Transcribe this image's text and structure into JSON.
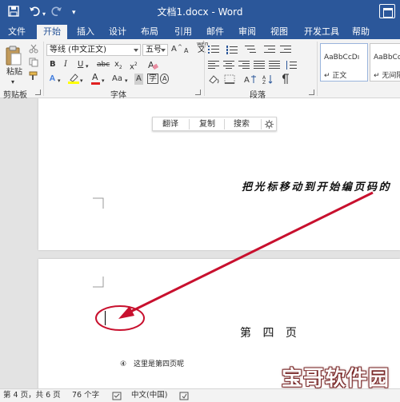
{
  "app": {
    "title": "文档1.docx - Word"
  },
  "quick_access": {
    "save_icon": "save-icon",
    "undo_icon": "undo-icon",
    "redo_icon": "redo-icon",
    "customize_icon": "customize-icon"
  },
  "tabs": [
    {
      "label": "文件"
    },
    {
      "label": "开始",
      "active": true
    },
    {
      "label": "插入"
    },
    {
      "label": "设计"
    },
    {
      "label": "布局"
    },
    {
      "label": "引用"
    },
    {
      "label": "邮件"
    },
    {
      "label": "审阅"
    },
    {
      "label": "视图"
    },
    {
      "label": "开发工具"
    },
    {
      "label": "帮助"
    }
  ],
  "ribbon": {
    "clipboard": {
      "paste_label": "粘贴",
      "group_label": "剪贴板"
    },
    "font": {
      "font_name": "等线 (中文正文)",
      "font_size": "五号",
      "grow": "A",
      "shrink": "A",
      "change_case": "Aa",
      "wen": "wén",
      "wen_glyph": "文",
      "bold": "B",
      "italic": "I",
      "underline": "U",
      "strike": "abc",
      "sub": "x",
      "sup": "x",
      "text_effect": "A",
      "font_color": "A",
      "shading_char": "A",
      "border_char": "字",
      "circle_char": "A",
      "group_label": "字体"
    },
    "paragraph": {
      "group_label": "段落"
    },
    "styles": {
      "items": [
        {
          "sample": "AaBbCcDı",
          "name": "↵ 正文"
        },
        {
          "sample": "AaBbCcDı",
          "name": "↵ 无间隔"
        }
      ]
    },
    "colors": {
      "ribbon_blue": "#2b579a",
      "font_color_red": "#e02020",
      "highlight_yellow": "#ffff00",
      "arrow_red": "#c8102e"
    }
  },
  "mini_toolbar": {
    "translate": "翻译",
    "copy": "复制",
    "search": "搜索",
    "settings_icon": "gear-icon"
  },
  "document": {
    "note": "把光标移动到开始编页码的",
    "heading": "第 四 页",
    "body_marker": "④",
    "body_text": "这里是第四页呢"
  },
  "status_bar": {
    "page": "第 4 页，共 6 页",
    "words": "76 个字",
    "language": "中文(中国)"
  },
  "watermark": {
    "text": "宝哥软件园"
  }
}
